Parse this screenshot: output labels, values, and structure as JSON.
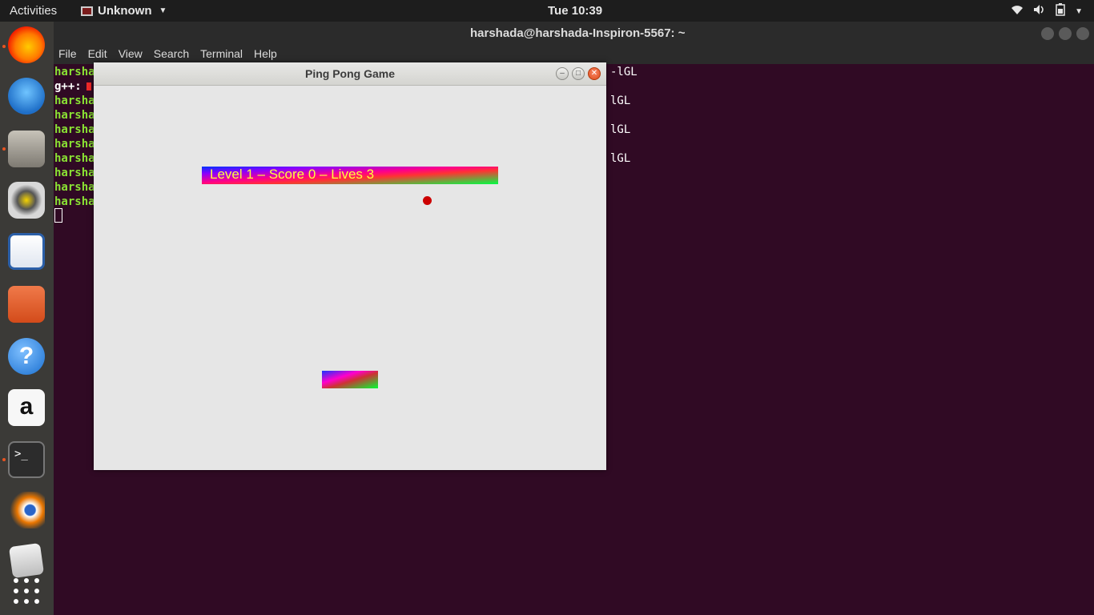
{
  "topbar": {
    "activities": "Activities",
    "app_name": "Unknown",
    "clock": "Tue 10:39",
    "tray_icons": [
      "wifi-icon",
      "volume-icon",
      "battery-icon",
      "power-menu-caret-icon"
    ]
  },
  "dock": {
    "items": [
      {
        "name": "firefox",
        "color": "#e66000",
        "running": true
      },
      {
        "name": "thunderbird",
        "color": "#2a6fb8",
        "running": false
      },
      {
        "name": "files",
        "color": "#8f8b82",
        "running": true
      },
      {
        "name": "rhythmbox",
        "color": "#d9b400",
        "running": false
      },
      {
        "name": "libreoffice-writer",
        "color": "#2b5fa8",
        "running": false
      },
      {
        "name": "ubuntu-software",
        "color": "#e95420",
        "running": false
      },
      {
        "name": "help",
        "color": "#3a8bdc",
        "running": false
      },
      {
        "name": "amazon",
        "color": "#f5f5f5",
        "running": false
      },
      {
        "name": "terminal",
        "color": "#2c2c2c",
        "running": true
      },
      {
        "name": "blender",
        "color": "#ea7600",
        "running": false
      },
      {
        "name": "text-editor",
        "color": "#cfcfcf",
        "running": false
      },
      {
        "name": "show-applications",
        "color": "#ffffff",
        "running": false
      }
    ]
  },
  "terminal": {
    "title": "harshada@harshada-Inspiron-5567: ~",
    "menu": [
      "File",
      "Edit",
      "View",
      "Search",
      "Terminal",
      "Help"
    ],
    "lines": [
      "harsha",
      "g++:",
      "harsha",
      "harsha",
      "harsha",
      "harsha",
      "harsha",
      "harsha",
      "harsha",
      "harsha"
    ],
    "right_fragments": [
      "-lGL",
      "lGL",
      "lGL",
      "lGL"
    ]
  },
  "game": {
    "title": "Ping Pong Game",
    "hud": "Level 1 – Score 0 – Lives 3",
    "colors": {
      "background": "#e6e6e6",
      "ball": "#cc0000",
      "hud_text": "#ffff3c"
    }
  }
}
